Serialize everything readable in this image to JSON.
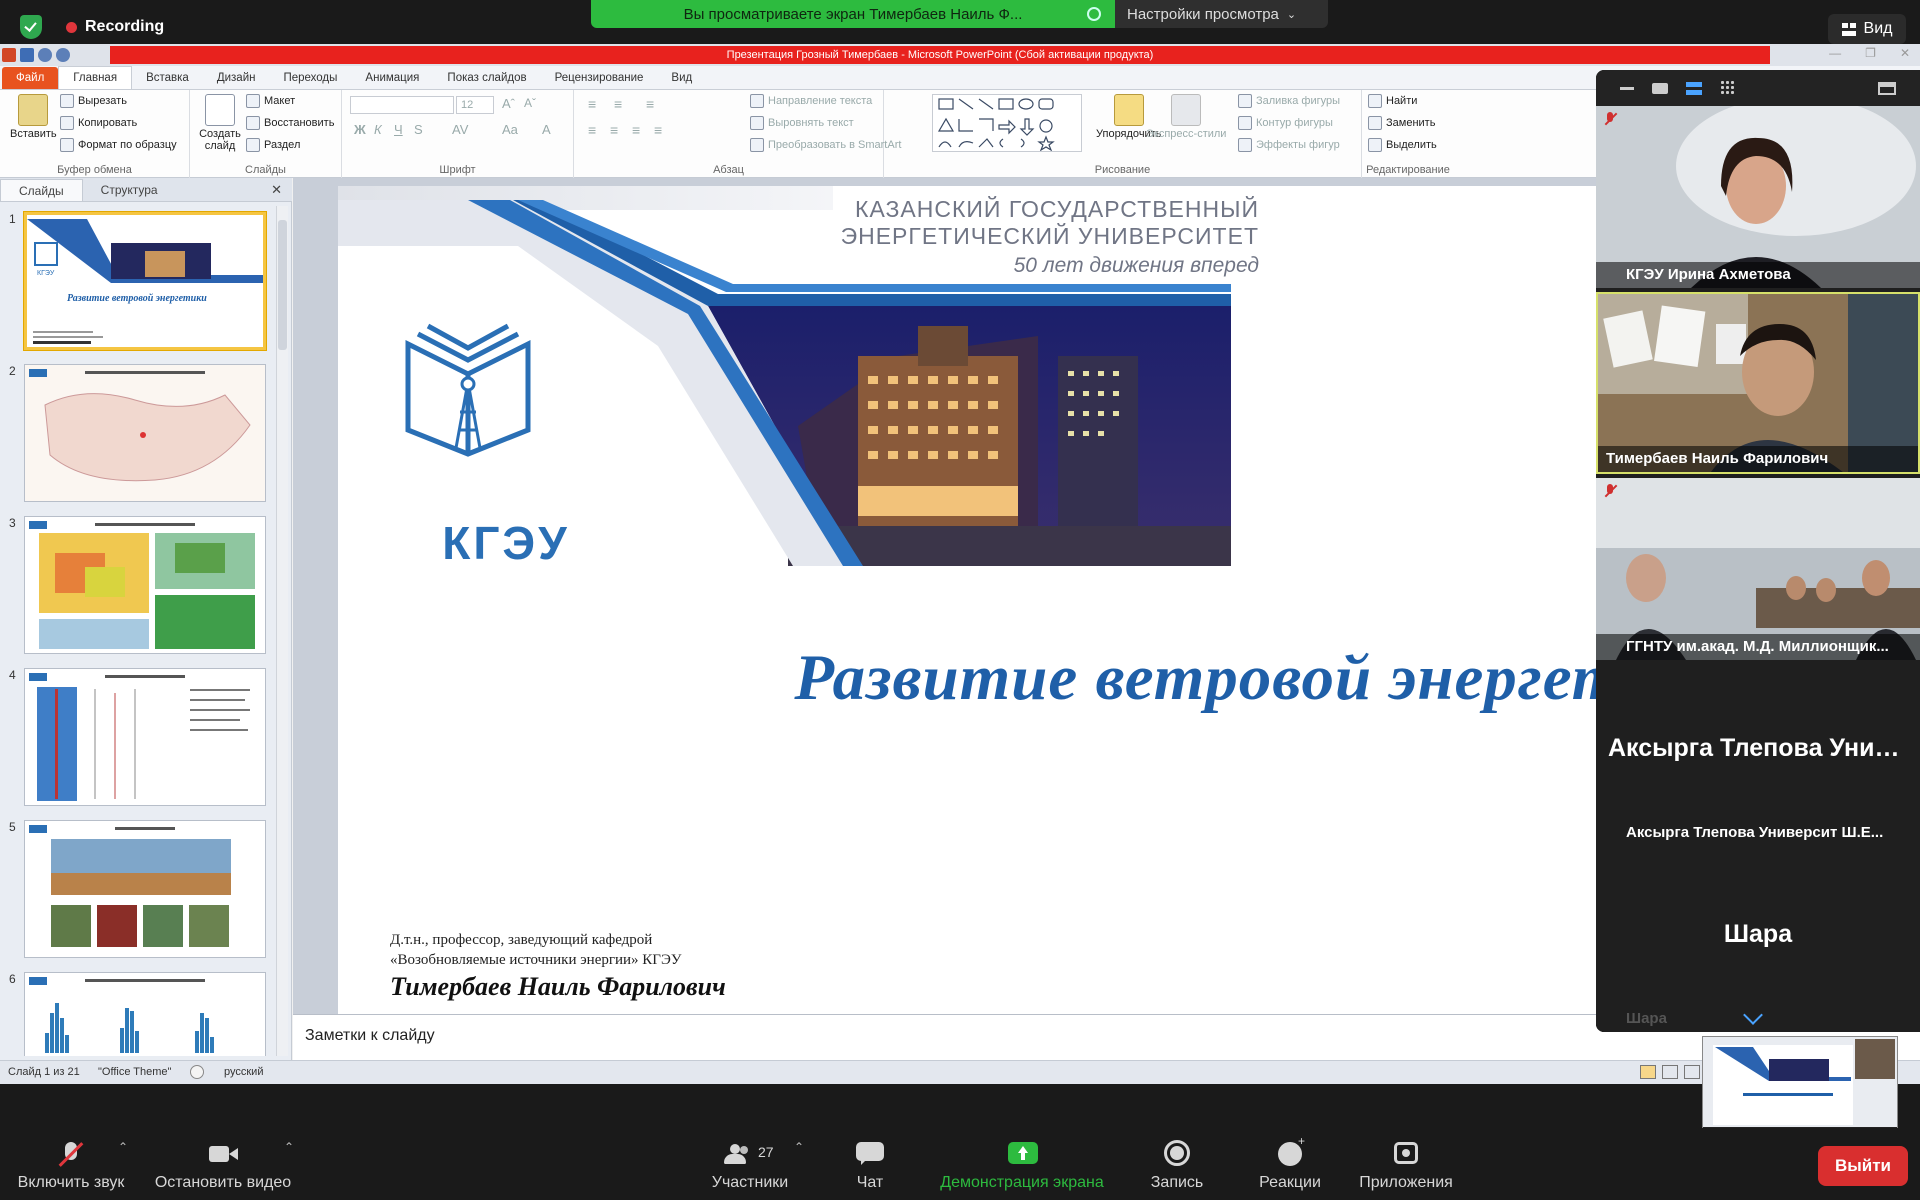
{
  "zoom": {
    "recording_label": "Recording",
    "share_banner": "Вы просматриваете экран Тимербаев Наиль Ф...",
    "view_options": "Настройки просмотра",
    "view_button": "Вид",
    "participants_count": "27",
    "toolbar": {
      "mute": "Включить звук",
      "video": "Остановить видео",
      "participants": "Участники",
      "chat": "Чат",
      "share": "Демонстрация экрана",
      "record": "Запись",
      "reactions": "Реакции",
      "apps": "Приложения",
      "leave": "Выйти"
    },
    "participants": [
      {
        "name": "КГЭУ Ирина Ахметова",
        "muted": true
      },
      {
        "name": "Тимербаев Наиль Фарилович",
        "muted": false
      },
      {
        "name": "ГГНТУ им.акад. М.Д. Миллионщик...",
        "muted": true
      },
      {
        "name": "Аксырга Тлепова Университ Ш.Е...",
        "big": "Аксырга Тлепова Унив...",
        "muted": true
      },
      {
        "name": "Шара",
        "big": "Шара",
        "muted": true
      }
    ]
  },
  "ppt": {
    "window_title": "Презентация Грозный Тимербаев  -  Microsoft PowerPoint (Сбой активации продукта)",
    "tabs": [
      "Файл",
      "Главная",
      "Вставка",
      "Дизайн",
      "Переходы",
      "Анимация",
      "Показ слайдов",
      "Рецензирование",
      "Вид"
    ],
    "ribbon": {
      "paste": "Вставить",
      "cut": "Вырезать",
      "copy": "Копировать",
      "format_painter": "Формат по образцу",
      "clipboard_group": "Буфер обмена",
      "new_slide": "Создать слайд",
      "layout": "Макет",
      "reset": "Восстановить",
      "section": "Раздел",
      "slides_group": "Слайды",
      "font_size": "12",
      "font_group": "Шрифт",
      "text_direction": "Направление текста",
      "align_text": "Выровнять текст",
      "smartart": "Преобразовать в SmartArt",
      "paragraph_group": "Абзац",
      "arrange": "Упорядочить",
      "quick_styles": "Экспресс-стили",
      "shape_fill": "Заливка фигуры",
      "shape_outline": "Контур фигуры",
      "shape_effects": "Эффекты фигур",
      "drawing_group": "Рисование",
      "find": "Найти",
      "replace": "Заменить",
      "select": "Выделить",
      "editing_group": "Редактирование"
    },
    "panel_tabs": [
      "Слайды",
      "Структура"
    ],
    "slide_count": 6,
    "notes_placeholder": "Заметки к слайду",
    "status": {
      "slide_info": "Слайд 1 из 21",
      "theme": "\"Office Theme\"",
      "language": "русский"
    },
    "slide": {
      "university_line1": "КАЗАНСКИЙ  ГОСУДАРСТВЕННЫЙ",
      "university_line2": "ЭНЕРГЕТИЧЕСКИЙ  УНИВЕРСИТЕТ",
      "motto": "50 лет движения вперед",
      "logo_text": "КГЭУ",
      "title": "Развитие ветровой энергетики",
      "author_line1": "Д.т.н., профессор, заведующий кафедрой",
      "author_line2": "«Возобновляемые источники энергии»  КГЭУ",
      "author_name": "Тимербаев Наиль Фарилович"
    }
  },
  "colors": {
    "accent_blue": "#1f5fa8",
    "zoom_green": "#2dbb3f",
    "leave_red": "#d92f2f"
  }
}
